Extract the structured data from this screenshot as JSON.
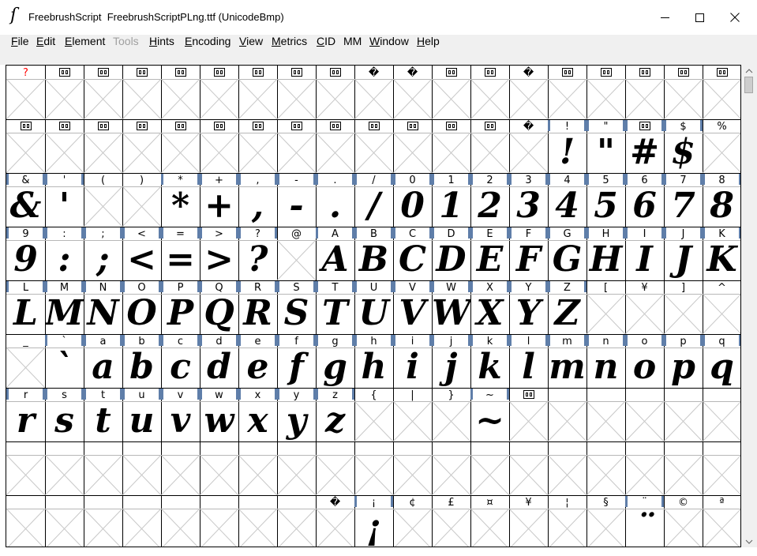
{
  "window": {
    "app_name": "FreebrushScript",
    "title": "FreebrushScript  FreebrushScriptPLng.ttf (UnicodeBmp)",
    "icon": "fontforge-icon",
    "controls": [
      "minimize-icon",
      "maximize-icon",
      "close-icon"
    ]
  },
  "menu": [
    {
      "label": "File",
      "enabled": true
    },
    {
      "label": "Edit",
      "enabled": true
    },
    {
      "label": "Element",
      "enabled": true
    },
    {
      "label": "Tools",
      "enabled": false
    },
    {
      "label": "Hints",
      "enabled": true
    },
    {
      "label": "Encoding",
      "enabled": true
    },
    {
      "label": "View",
      "enabled": true
    },
    {
      "label": "Metrics",
      "enabled": true
    },
    {
      "label": "CID",
      "enabled": true
    },
    {
      "label": "MM",
      "enabled": true
    },
    {
      "label": "Window",
      "enabled": true
    },
    {
      "label": "Help",
      "enabled": true
    }
  ],
  "grid": {
    "columns": 19,
    "rows": [
      {
        "labels": [
          "?",
          "#",
          "#",
          "#",
          "#",
          "#",
          "#",
          "#",
          "#",
          "�",
          "�",
          "#",
          "#",
          "�",
          "#",
          "#",
          "#",
          "#",
          "#"
        ],
        "glyphs": [
          "",
          "",
          "",
          "",
          "",
          "",
          "",
          "",
          "",
          "",
          "",
          "",
          "",
          "",
          "",
          "",
          "",
          "",
          ""
        ]
      },
      {
        "labels": [
          "#",
          "#",
          "#",
          "#",
          "#",
          "#",
          "#",
          "#",
          "#",
          "#",
          "#",
          "#",
          "#",
          "�",
          "!",
          "\"",
          "#",
          "$",
          "%"
        ],
        "glyphs": [
          "",
          "",
          "",
          "",
          "",
          "",
          "",
          "",
          "",
          "",
          "",
          "",
          "",
          "",
          "!",
          "\"",
          "#",
          "$",
          ""
        ]
      },
      {
        "labels": [
          "&",
          "'",
          "(",
          ")",
          "*",
          "+",
          ",",
          "-",
          ".",
          "/",
          "0",
          "1",
          "2",
          "3",
          "4",
          "5",
          "6",
          "7",
          "8"
        ],
        "glyphs": [
          "&",
          "'",
          "",
          "",
          "*",
          "+",
          ",",
          "-",
          ".",
          "/",
          "0",
          "1",
          "2",
          "3",
          "4",
          "5",
          "6",
          "7",
          "8"
        ]
      },
      {
        "labels": [
          "9",
          ":",
          ";",
          "<",
          "=",
          ">",
          "?",
          "@",
          "A",
          "B",
          "C",
          "D",
          "E",
          "F",
          "G",
          "H",
          "I",
          "J",
          "K"
        ],
        "glyphs": [
          "9",
          ":",
          ";",
          "<",
          "=",
          ">",
          "?",
          "",
          "A",
          "B",
          "C",
          "D",
          "E",
          "F",
          "G",
          "H",
          "I",
          "J",
          "K"
        ]
      },
      {
        "labels": [
          "L",
          "M",
          "N",
          "O",
          "P",
          "Q",
          "R",
          "S",
          "T",
          "U",
          "V",
          "W",
          "X",
          "Y",
          "Z",
          "[",
          "¥",
          "]",
          "^"
        ],
        "glyphs": [
          "L",
          "M",
          "N",
          "O",
          "P",
          "Q",
          "R",
          "S",
          "T",
          "U",
          "V",
          "W",
          "X",
          "Y",
          "Z",
          "",
          "",
          "",
          ""
        ]
      },
      {
        "labels": [
          "_",
          "`",
          "a",
          "b",
          "c",
          "d",
          "e",
          "f",
          "g",
          "h",
          "i",
          "j",
          "k",
          "l",
          "m",
          "n",
          "o",
          "p",
          "q"
        ],
        "glyphs": [
          "",
          "`",
          "a",
          "b",
          "c",
          "d",
          "e",
          "f",
          "g",
          "h",
          "i",
          "j",
          "k",
          "l",
          "m",
          "n",
          "o",
          "p",
          "q"
        ]
      },
      {
        "labels": [
          "r",
          "s",
          "t",
          "u",
          "v",
          "w",
          "x",
          "y",
          "z",
          "{",
          "|",
          "}",
          "~",
          "#",
          "",
          "",
          "",
          "",
          ""
        ],
        "glyphs": [
          "r",
          "s",
          "t",
          "u",
          "v",
          "w",
          "x",
          "y",
          "z",
          "",
          "",
          "",
          "~",
          "",
          "",
          "",
          "",
          "",
          ""
        ]
      },
      {
        "labels": [
          "",
          "",
          "",
          "",
          "",
          "",
          "",
          "",
          "",
          "",
          "",
          "",
          "",
          "",
          "",
          "",
          "",
          "",
          ""
        ],
        "glyphs": [
          "",
          "",
          "",
          "",
          "",
          "",
          "",
          "",
          "",
          "",
          "",
          "",
          "",
          "",
          "",
          "",
          "",
          "",
          ""
        ]
      },
      {
        "labels": [
          "",
          "",
          "",
          "",
          "",
          "",
          "",
          "",
          "�",
          "¡",
          "¢",
          "£",
          "¤",
          "¥",
          "¦",
          "§",
          "¨",
          "©",
          "ª"
        ],
        "glyphs": [
          "",
          "",
          "",
          "",
          "",
          "",
          "",
          "",
          "",
          "¡",
          "",
          "",
          "",
          "",
          "",
          "",
          "¨",
          "",
          ""
        ]
      }
    ]
  },
  "colors": {
    "accent_tick": "#5f7ea9",
    "missing_red": "#ff0000",
    "grid_line": "#000000",
    "menubar_bg": "#f0f0f0"
  }
}
